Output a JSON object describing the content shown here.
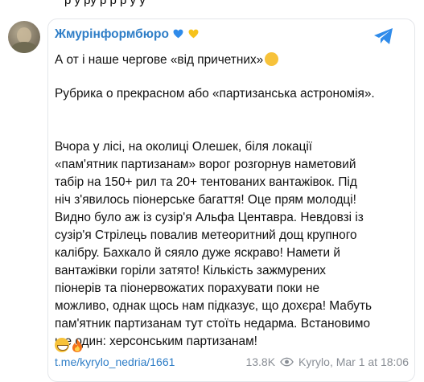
{
  "top_partial_text": "р у ру р р р у у",
  "channel": {
    "name": "Жмурінформбюро"
  },
  "message": {
    "line1": "А от і наше чергове «від причетних»",
    "line2": "Рубрика о прекрасном або «партизанська астрономія».",
    "body": "Вчора у лісі, на околиці Олешек, біля локації\n«пам'ятник партизанам» ворог розгорнув наметовий\nтабір на 150+ рил та 20+ тентованих вантажівок. Під\nніч з'явилось піонерське багаття! Оце прям молодці!\nВидно було аж із сузір'я Альфа Центавра. Невдовзі із\nсузір'я Стрілець повалив метеоритний дощ крупного\nкалібру. Бахкало й сяяло дуже яскраво! Намети й\nвантажівки горіли затято! Кількість зажмурених\nпіонерів та піонервожатих порахувати поки не\nможливо, однак щось нам підказує, що дохєра! Мабуть\nпам'ятник партизанам тут стоїть недарма. Встановимо\nще один: херсонським партизанам!"
  },
  "footer": {
    "link": "t.me/kyrylo_nedria/1661",
    "views": "13.8K",
    "author_date": "Kyrylo, Mar 1 at 18:06"
  },
  "icons": {
    "send": "telegram-plane-icon",
    "views": "eye-icon",
    "hearts": [
      "blue-heart-icon",
      "yellow-heart-icon"
    ],
    "reactions": [
      "grinning-face-icon",
      "fire-icon"
    ],
    "smirk": "smirking-face-icon"
  },
  "colors": {
    "accent": "#2f7ec7",
    "muted": "#8a8f96",
    "heart_blue": "#2f8bea",
    "heart_yellow": "#f6c21a",
    "fire": "#f4731b"
  }
}
